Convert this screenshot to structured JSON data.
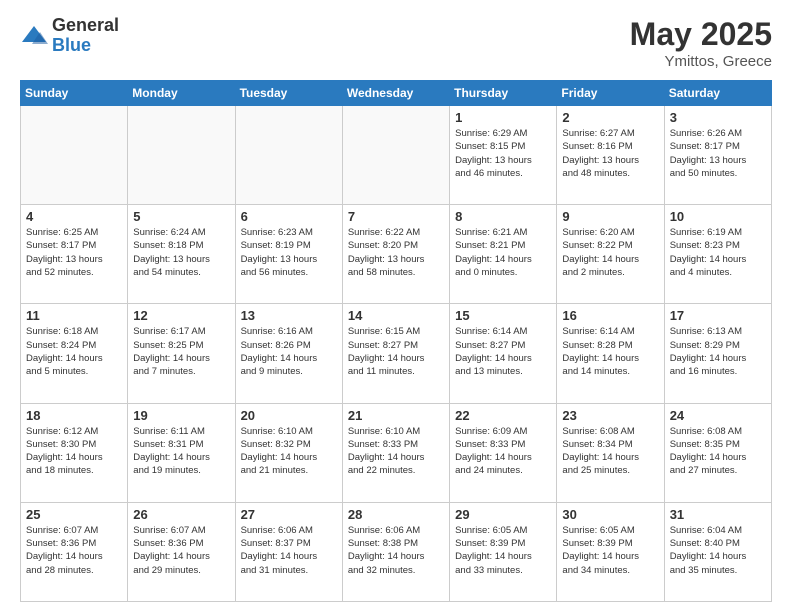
{
  "header": {
    "logo_general": "General",
    "logo_blue": "Blue",
    "title": "May 2025",
    "location": "Ymittos, Greece"
  },
  "days_of_week": [
    "Sunday",
    "Monday",
    "Tuesday",
    "Wednesday",
    "Thursday",
    "Friday",
    "Saturday"
  ],
  "weeks": [
    [
      {
        "day": "",
        "info": ""
      },
      {
        "day": "",
        "info": ""
      },
      {
        "day": "",
        "info": ""
      },
      {
        "day": "",
        "info": ""
      },
      {
        "day": "1",
        "info": "Sunrise: 6:29 AM\nSunset: 8:15 PM\nDaylight: 13 hours\nand 46 minutes."
      },
      {
        "day": "2",
        "info": "Sunrise: 6:27 AM\nSunset: 8:16 PM\nDaylight: 13 hours\nand 48 minutes."
      },
      {
        "day": "3",
        "info": "Sunrise: 6:26 AM\nSunset: 8:17 PM\nDaylight: 13 hours\nand 50 minutes."
      }
    ],
    [
      {
        "day": "4",
        "info": "Sunrise: 6:25 AM\nSunset: 8:17 PM\nDaylight: 13 hours\nand 52 minutes."
      },
      {
        "day": "5",
        "info": "Sunrise: 6:24 AM\nSunset: 8:18 PM\nDaylight: 13 hours\nand 54 minutes."
      },
      {
        "day": "6",
        "info": "Sunrise: 6:23 AM\nSunset: 8:19 PM\nDaylight: 13 hours\nand 56 minutes."
      },
      {
        "day": "7",
        "info": "Sunrise: 6:22 AM\nSunset: 8:20 PM\nDaylight: 13 hours\nand 58 minutes."
      },
      {
        "day": "8",
        "info": "Sunrise: 6:21 AM\nSunset: 8:21 PM\nDaylight: 14 hours\nand 0 minutes."
      },
      {
        "day": "9",
        "info": "Sunrise: 6:20 AM\nSunset: 8:22 PM\nDaylight: 14 hours\nand 2 minutes."
      },
      {
        "day": "10",
        "info": "Sunrise: 6:19 AM\nSunset: 8:23 PM\nDaylight: 14 hours\nand 4 minutes."
      }
    ],
    [
      {
        "day": "11",
        "info": "Sunrise: 6:18 AM\nSunset: 8:24 PM\nDaylight: 14 hours\nand 5 minutes."
      },
      {
        "day": "12",
        "info": "Sunrise: 6:17 AM\nSunset: 8:25 PM\nDaylight: 14 hours\nand 7 minutes."
      },
      {
        "day": "13",
        "info": "Sunrise: 6:16 AM\nSunset: 8:26 PM\nDaylight: 14 hours\nand 9 minutes."
      },
      {
        "day": "14",
        "info": "Sunrise: 6:15 AM\nSunset: 8:27 PM\nDaylight: 14 hours\nand 11 minutes."
      },
      {
        "day": "15",
        "info": "Sunrise: 6:14 AM\nSunset: 8:27 PM\nDaylight: 14 hours\nand 13 minutes."
      },
      {
        "day": "16",
        "info": "Sunrise: 6:14 AM\nSunset: 8:28 PM\nDaylight: 14 hours\nand 14 minutes."
      },
      {
        "day": "17",
        "info": "Sunrise: 6:13 AM\nSunset: 8:29 PM\nDaylight: 14 hours\nand 16 minutes."
      }
    ],
    [
      {
        "day": "18",
        "info": "Sunrise: 6:12 AM\nSunset: 8:30 PM\nDaylight: 14 hours\nand 18 minutes."
      },
      {
        "day": "19",
        "info": "Sunrise: 6:11 AM\nSunset: 8:31 PM\nDaylight: 14 hours\nand 19 minutes."
      },
      {
        "day": "20",
        "info": "Sunrise: 6:10 AM\nSunset: 8:32 PM\nDaylight: 14 hours\nand 21 minutes."
      },
      {
        "day": "21",
        "info": "Sunrise: 6:10 AM\nSunset: 8:33 PM\nDaylight: 14 hours\nand 22 minutes."
      },
      {
        "day": "22",
        "info": "Sunrise: 6:09 AM\nSunset: 8:33 PM\nDaylight: 14 hours\nand 24 minutes."
      },
      {
        "day": "23",
        "info": "Sunrise: 6:08 AM\nSunset: 8:34 PM\nDaylight: 14 hours\nand 25 minutes."
      },
      {
        "day": "24",
        "info": "Sunrise: 6:08 AM\nSunset: 8:35 PM\nDaylight: 14 hours\nand 27 minutes."
      }
    ],
    [
      {
        "day": "25",
        "info": "Sunrise: 6:07 AM\nSunset: 8:36 PM\nDaylight: 14 hours\nand 28 minutes."
      },
      {
        "day": "26",
        "info": "Sunrise: 6:07 AM\nSunset: 8:36 PM\nDaylight: 14 hours\nand 29 minutes."
      },
      {
        "day": "27",
        "info": "Sunrise: 6:06 AM\nSunset: 8:37 PM\nDaylight: 14 hours\nand 31 minutes."
      },
      {
        "day": "28",
        "info": "Sunrise: 6:06 AM\nSunset: 8:38 PM\nDaylight: 14 hours\nand 32 minutes."
      },
      {
        "day": "29",
        "info": "Sunrise: 6:05 AM\nSunset: 8:39 PM\nDaylight: 14 hours\nand 33 minutes."
      },
      {
        "day": "30",
        "info": "Sunrise: 6:05 AM\nSunset: 8:39 PM\nDaylight: 14 hours\nand 34 minutes."
      },
      {
        "day": "31",
        "info": "Sunrise: 6:04 AM\nSunset: 8:40 PM\nDaylight: 14 hours\nand 35 minutes."
      }
    ]
  ]
}
